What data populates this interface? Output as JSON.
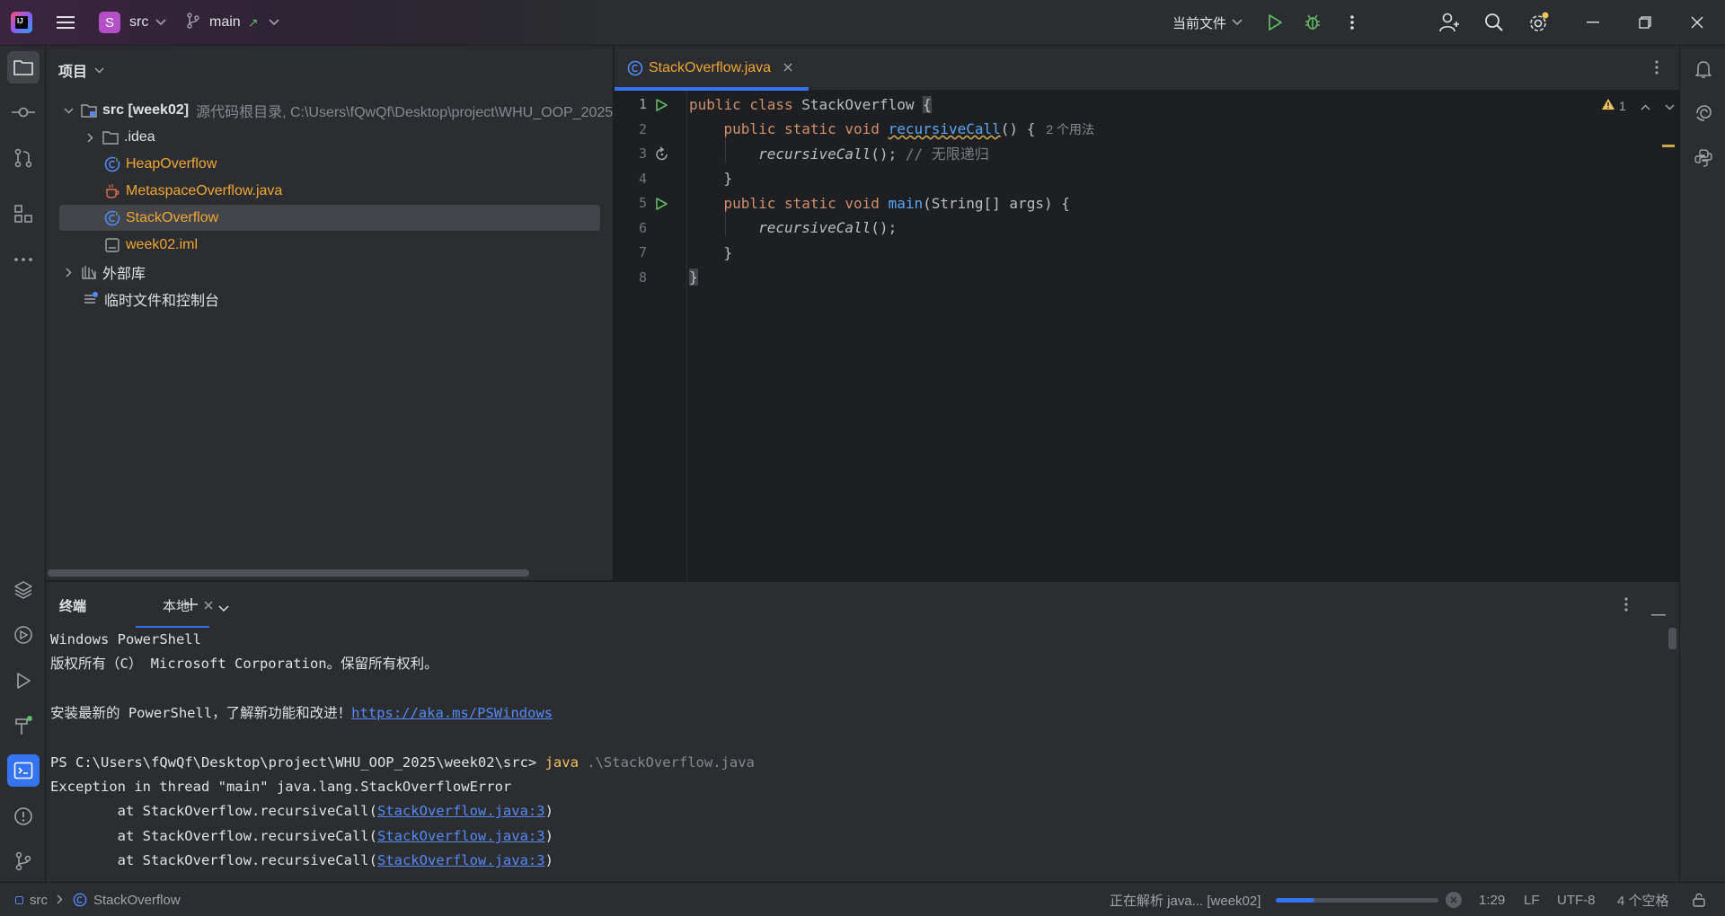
{
  "titlebar": {
    "project_badge": "S",
    "project_name": "src",
    "branch": "main",
    "run_config": "当前文件"
  },
  "project_panel": {
    "title": "项目",
    "tree": [
      {
        "label": "src [week02]",
        "hint": "源代码根目录, C:\\Users\\fQwQf\\Desktop\\project\\WHU_OOP_2025",
        "icon": "folder-icon"
      },
      {
        "label": ".idea",
        "icon": "folder-icon"
      },
      {
        "label": "HeapOverflow",
        "icon": "java-class-icon"
      },
      {
        "label": "MetaspaceOverflow.java",
        "icon": "java-file-icon"
      },
      {
        "label": "StackOverflow",
        "icon": "java-class-icon",
        "selected": true
      },
      {
        "label": "week02.iml",
        "icon": "module-file-icon"
      },
      {
        "label": "外部库",
        "icon": "library-icon"
      },
      {
        "label": "临时文件和控制台",
        "icon": "scratches-icon"
      }
    ]
  },
  "editor": {
    "tab_label": "StackOverflow.java",
    "warning_count": "1",
    "line_numbers": [
      "1",
      "2",
      "3",
      "4",
      "5",
      "6",
      "7",
      "8"
    ],
    "usage_hint": "2 个用法",
    "comment": "// 无限递归"
  },
  "terminal": {
    "tab_terminal": "终端",
    "tab_local": "本地",
    "lines": {
      "l1": "Windows PowerShell",
      "l2": "版权所有（C） Microsoft Corporation。保留所有权利。",
      "l3_text": "安装最新的 PowerShell，了解新功能和改进！",
      "l3_link": "https://aka.ms/PSWindows",
      "l4_prompt": "PS C:\\Users\\fQwQf\\Desktop\\project\\WHU_OOP_2025\\week02\\src> ",
      "l4_cmd": "java",
      "l4_arg": " .\\StackOverflow.java",
      "l5": "Exception in thread \"main\" java.lang.StackOverflowError",
      "trace_prefix": "        at StackOverflow.recursiveCall(",
      "trace_link": "StackOverflow.java:3",
      "trace_suffix": ")"
    }
  },
  "statusbar": {
    "crumb_root": "src",
    "crumb_file": "StackOverflow",
    "task": "正在解析 java... [week02]",
    "progress": 0.24,
    "position": "1:29",
    "line_sep": "LF",
    "encoding": "UTF-8",
    "indent": "4 个空格"
  },
  "colors": {
    "accent": "#3574f0",
    "keyword": "#cf8e6d",
    "function": "#56a8f5",
    "tab_file": "#f0a732",
    "run_green": "#5fb865"
  }
}
